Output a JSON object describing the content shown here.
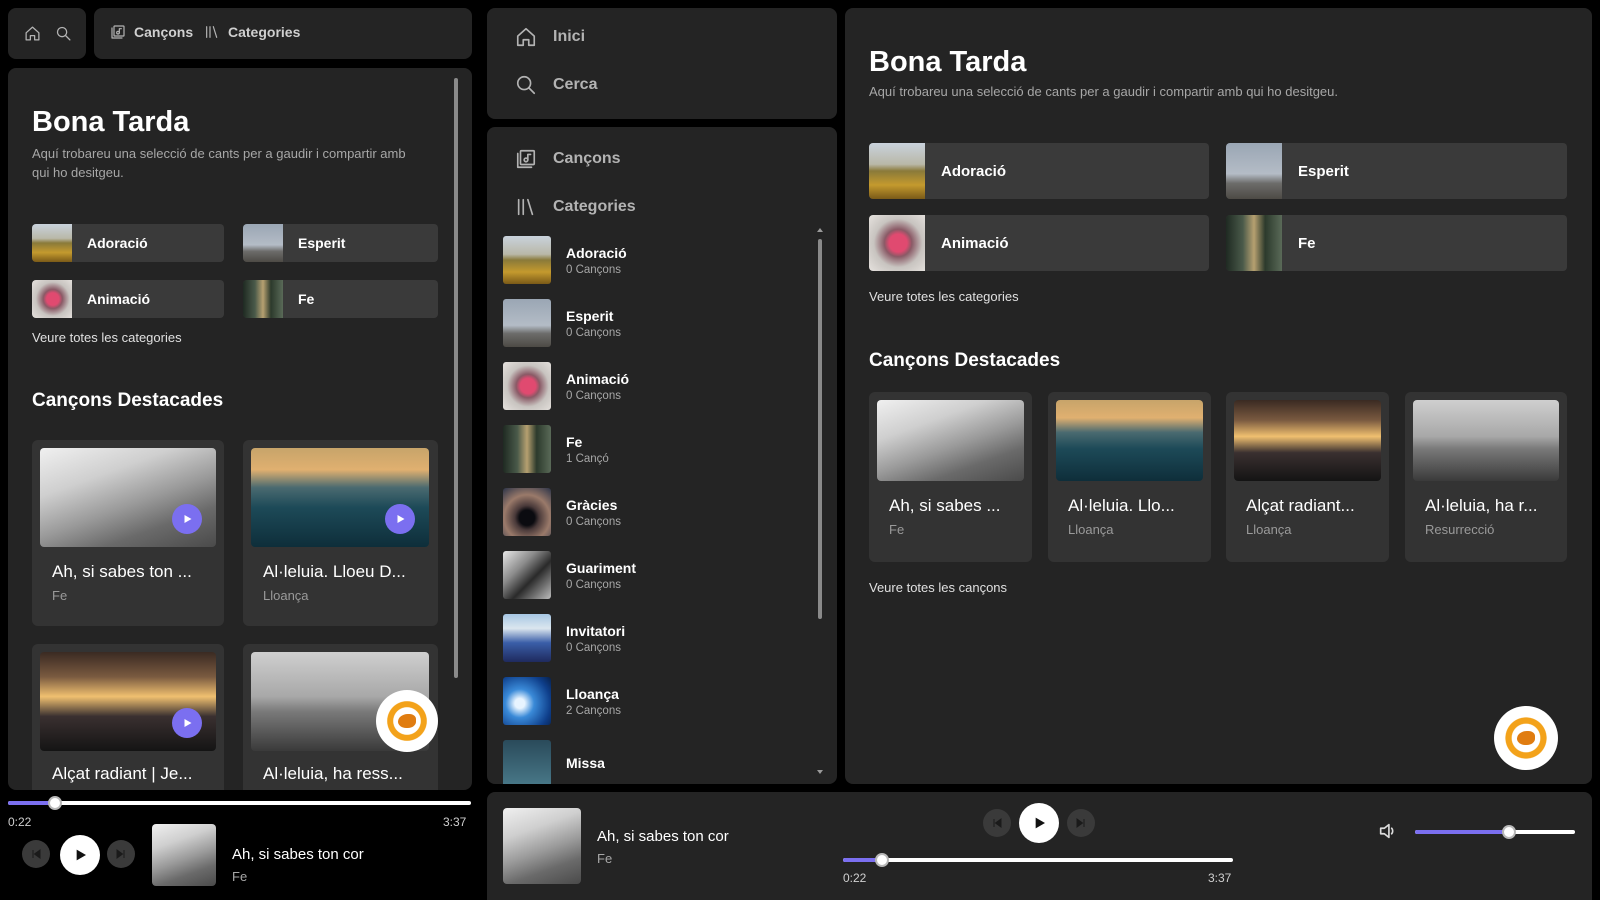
{
  "nav": {
    "home_icon": "home-icon",
    "search_icon": "search-icon",
    "songs": "Cançons",
    "categories": "Categories"
  },
  "sidebar": {
    "home": "Inici",
    "search": "Cerca",
    "songs": "Cançons",
    "categories": "Categories"
  },
  "category_list": [
    {
      "name": "Adoració",
      "count": "0 Cançons"
    },
    {
      "name": "Esperit",
      "count": "0 Cançons"
    },
    {
      "name": "Animació",
      "count": "0 Cançons"
    },
    {
      "name": "Fe",
      "count": "1 Cançó"
    },
    {
      "name": "Gràcies",
      "count": "0 Cançons"
    },
    {
      "name": "Guariment",
      "count": "0 Cançons"
    },
    {
      "name": "Invitatori",
      "count": "0 Cançons"
    },
    {
      "name": "Lloança",
      "count": "2 Cançons"
    },
    {
      "name": "Missa",
      "count": ""
    }
  ],
  "main": {
    "greeting": "Bona Tarda",
    "intro": "Aquí trobareu una selecció de cants per a gaudir i compartir amb qui ho desitgeu.",
    "quick_categories": [
      "Adoració",
      "Esperit",
      "Animació",
      "Fe"
    ],
    "see_all_categories": "Veure totes les categories",
    "featured_title": "Cançons Destacades",
    "see_all_songs": "Veure totes les cançons"
  },
  "songs_small": [
    {
      "title": "Ah, si sabes ton ...",
      "category": "Fe"
    },
    {
      "title": "Al·leluia. Lloeu D...",
      "category": "Lloança"
    },
    {
      "title": "Alçat radiant | Je...",
      "category": ""
    },
    {
      "title": "Al·leluia, ha ress...",
      "category": ""
    }
  ],
  "songs_large": [
    {
      "title": "Ah, si sabes ...",
      "category": "Fe"
    },
    {
      "title": "Al·leluia. Llo...",
      "category": "Lloança"
    },
    {
      "title": "Alçat radiant...",
      "category": "Lloança"
    },
    {
      "title": "Al·leluia, ha r...",
      "category": "Resurrecció"
    }
  ],
  "player": {
    "title": "Ah, si sabes ton cor",
    "category": "Fe",
    "elapsed": "0:22",
    "duration": "3:37",
    "progress": 0.101,
    "volume": 0.59
  },
  "colors": {
    "accent": "#7b6ff0",
    "panel": "#242424",
    "card": "#3a3a3a"
  }
}
